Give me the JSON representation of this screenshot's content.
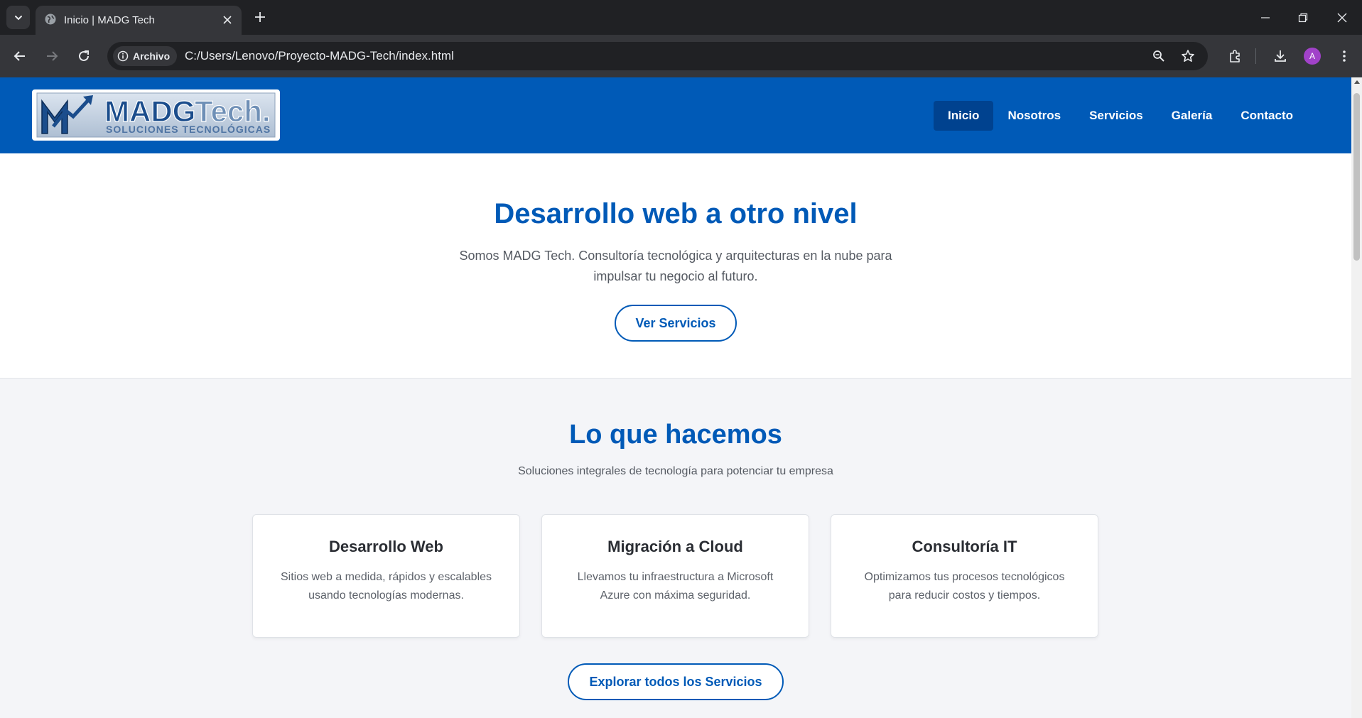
{
  "browser": {
    "tab_title": "Inicio | MADG Tech",
    "site_chip_label": "Archivo",
    "url": "C:/Users/Lenovo/Proyecto-MADG-Tech/index.html",
    "avatar_letter": "A"
  },
  "header": {
    "logo_text_main": "MADG",
    "logo_text_accent": "Tech.",
    "logo_tagline": "SOLUCIONES TECNOLÓGICAS",
    "nav": [
      {
        "label": "Inicio",
        "active": true
      },
      {
        "label": "Nosotros"
      },
      {
        "label": "Servicios"
      },
      {
        "label": "Galería"
      },
      {
        "label": "Contacto"
      }
    ]
  },
  "hero": {
    "title": "Desarrollo web a otro nivel",
    "text": "Somos MADG Tech. Consultoría tecnológica y arquitecturas en la nube para impulsar tu negocio al futuro.",
    "button": "Ver Servicios"
  },
  "services": {
    "title": "Lo que hacemos",
    "subtitle": "Soluciones integrales de tecnología para potenciar tu empresa",
    "cards": [
      {
        "title": "Desarrollo Web",
        "text": "Sitios web a medida, rápidos y escalables usando tecnologías modernas."
      },
      {
        "title": "Migración a Cloud",
        "text": "Llevamos tu infraestructura a Microsoft Azure con máxima seguridad."
      },
      {
        "title": "Consultoría IT",
        "text": "Optimizamos tus procesos tecnológicos para reducir costos y tiempos."
      }
    ],
    "button": "Explorar todos los Servicios"
  },
  "colors": {
    "brand_blue": "#005ab7",
    "nav_active": "#00428f",
    "chrome_dark": "#202124",
    "chrome_toolbar": "#35363a"
  }
}
